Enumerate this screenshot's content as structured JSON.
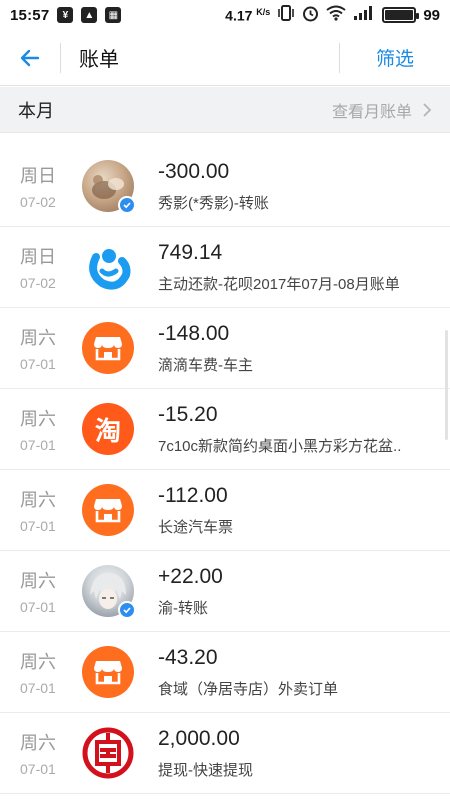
{
  "status_bar": {
    "time": "15:57",
    "net_speed": "4.17",
    "net_unit": "K/s",
    "battery_level": "99",
    "battery_percent": 0.99
  },
  "header": {
    "title": "账单",
    "filter_label": "筛选"
  },
  "month": {
    "label": "本月",
    "link_label": "查看月账单"
  },
  "transactions": [
    {
      "weekday": "周日",
      "date": "07-02",
      "amount": "-300.00",
      "desc": "秀影(*秀影)-转账",
      "icon": "personal-photo-avatar",
      "verified": true
    },
    {
      "weekday": "周日",
      "date": "07-02",
      "amount": "749.14",
      "desc": "主动还款-花呗2017年07月-08月账单",
      "icon": "huabei-icon"
    },
    {
      "weekday": "周六",
      "date": "07-01",
      "amount": "-148.00",
      "desc": "滴滴车费-车主",
      "icon": "shop-icon"
    },
    {
      "weekday": "周六",
      "date": "07-01",
      "amount": "-15.20",
      "desc": "7c10c新款简约桌面小黑方彩方花盆..",
      "icon": "taobao-icon",
      "icon_text": "淘"
    },
    {
      "weekday": "周六",
      "date": "07-01",
      "amount": "-112.00",
      "desc": "长途汽车票",
      "icon": "shop-icon"
    },
    {
      "weekday": "周六",
      "date": "07-01",
      "amount": "+22.00",
      "desc": "渝-转账",
      "icon": "anime-avatar",
      "verified": true
    },
    {
      "weekday": "周六",
      "date": "07-01",
      "amount": "-43.20",
      "desc": "食域（净居寺店）外卖订单",
      "icon": "shop-icon"
    },
    {
      "weekday": "周六",
      "date": "07-01",
      "amount": "2,000.00",
      "desc": "提现-快速提现",
      "icon": "icbc-icon"
    }
  ],
  "colors": {
    "accent": "#1a8ae5",
    "shop_orange": "#ff6e1f",
    "taobao_orange": "#ff5a1a",
    "icbc_red": "#d3111c"
  }
}
